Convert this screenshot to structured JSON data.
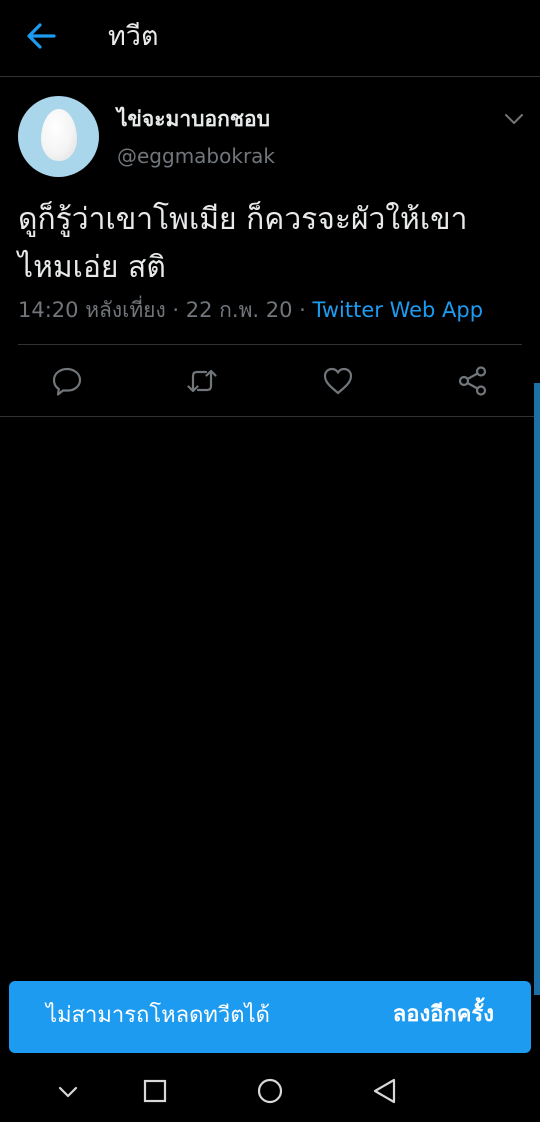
{
  "header": {
    "title": "ทวีต"
  },
  "tweet": {
    "display_name": "ไข่จะมาบอกชอบ",
    "handle": "@eggmabokrak",
    "text": "ดูก็รู้ว่าเขาโพเมีย ก็ควรจะผัวให้เขาไหมเอ่ย สติ",
    "time": "14:20 หลังเที่ยง",
    "separator_1": " · ",
    "date": "22 ก.พ. 20",
    "separator_2": " · ",
    "source": "Twitter Web App"
  },
  "actions": {
    "icons": [
      "reply-icon",
      "retweet-icon",
      "like-icon",
      "share-icon"
    ]
  },
  "toast": {
    "message": "ไม่สามารถโหลดทวีตได้",
    "action_label": "ลองอีกครั้ง"
  },
  "navbar": {
    "icons": [
      "chevron-down-icon",
      "square-icon",
      "circle-icon",
      "triangle-back-icon"
    ]
  },
  "colors": {
    "background": "#000000",
    "accent": "#1d9bf0",
    "text_primary": "#e7e9ea",
    "text_secondary": "#71767b",
    "divider": "#2f3336",
    "avatar_bg": "#a9d6ea"
  }
}
